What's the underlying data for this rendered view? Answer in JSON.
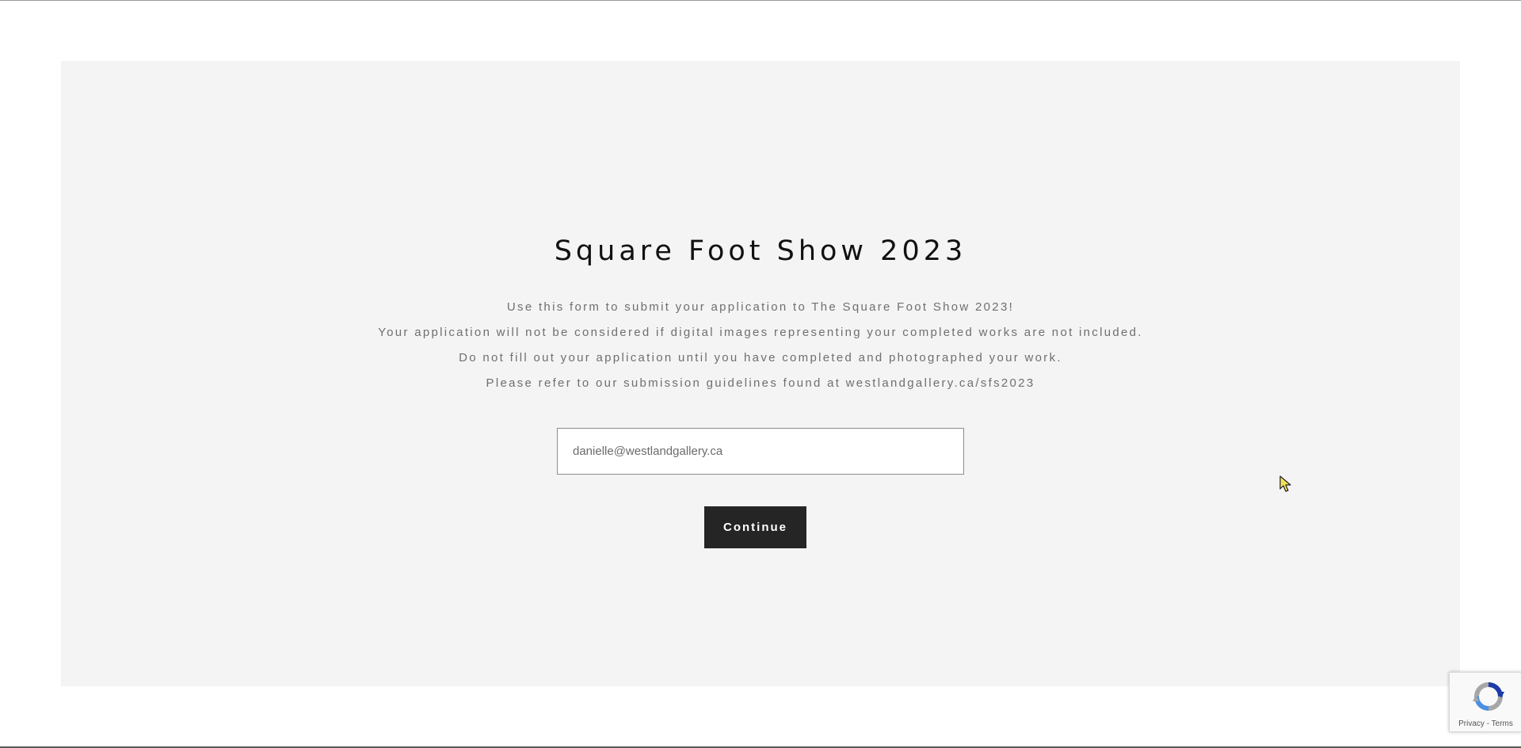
{
  "form": {
    "title": "Square Foot Show 2023",
    "description_lines": [
      "Use this form to submit your application to The Square Foot Show 2023!",
      "Your application will not be considered if digital images representing your completed works are not included.",
      "Do not fill out your application until you have completed and photographed your work.",
      "Please refer to our submission guidelines found at westlandgallery.ca/sfs2023"
    ],
    "email_value": "danielle@westlandgallery.ca",
    "continue_label": "Continue"
  },
  "recaptcha": {
    "privacy_label": "Privacy",
    "separator": " - ",
    "terms_label": "Terms"
  },
  "colors": {
    "panel_background": "#f4f4f4",
    "button_background": "#252525",
    "text_muted": "#6f6f6f"
  }
}
